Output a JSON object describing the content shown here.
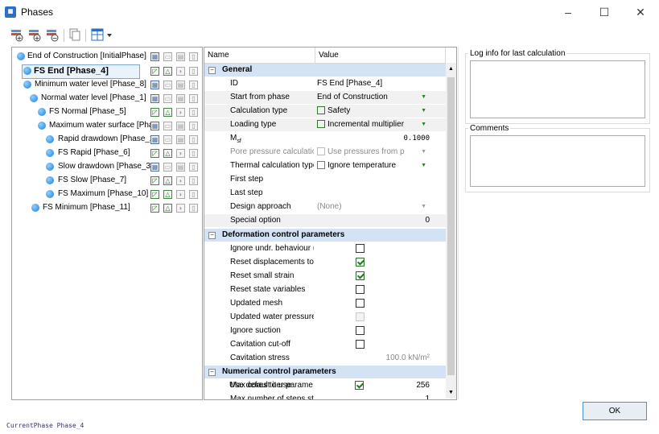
{
  "window": {
    "title": "Phases",
    "app_icon": "plaxis-icon"
  },
  "toolbar": {
    "buttons": [
      "add-phase-icon",
      "insert-phase-icon",
      "delete-phase-icon",
      "copy-icon",
      "view-options-icon"
    ]
  },
  "tree": {
    "phases": [
      {
        "label": "End of Construction [InitialPhase]",
        "indent": 0,
        "bold": false,
        "icons": [
          "calc-type-icon",
          "loading-icon",
          "pore-pressure-icon",
          "thermal-icon"
        ]
      },
      {
        "label": "FS End [Phase_4]",
        "indent": 1,
        "bold": true,
        "selected": true,
        "icons": [
          "safety-icon",
          "incremental-icon",
          "water-icon",
          "thermal-icon"
        ]
      },
      {
        "label": "Minimum water level [Phase_8]",
        "indent": 1,
        "bold": false,
        "icons": [
          "plastic-icon",
          "loading-icon",
          "pore-pressure-icon",
          "thermal-icon"
        ]
      },
      {
        "label": "Normal water level [Phase_1]",
        "indent": 2,
        "bold": false,
        "icons": [
          "plastic-icon",
          "loading-icon",
          "pore-pressure-icon",
          "thermal-icon"
        ]
      },
      {
        "label": "FS Normal [Phase_5]",
        "indent": 3,
        "bold": false,
        "icons": [
          "safety-icon",
          "incremental-icon",
          "water-icon",
          "thermal-icon"
        ]
      },
      {
        "label": "Maximum water surface [Pha",
        "indent": 3,
        "bold": false,
        "icons": [
          "plastic-icon",
          "loading-icon",
          "pore-pressure-icon",
          "thermal-icon"
        ]
      },
      {
        "label": "Rapid drawdown [Phase_2",
        "indent": 4,
        "bold": false,
        "icons": [
          "plastic-icon",
          "loading-icon",
          "pore-pressure-icon",
          "thermal-icon"
        ]
      },
      {
        "label": "FS Rapid [Phase_6]",
        "indent": 4,
        "bold": false,
        "icons": [
          "safety-icon",
          "incremental-icon",
          "water-icon",
          "thermal-icon"
        ]
      },
      {
        "label": "Slow drawdown [Phase_3]",
        "indent": 4,
        "bold": false,
        "icons": [
          "plastic-icon",
          "loading-icon",
          "pore-pressure-icon",
          "thermal-icon"
        ]
      },
      {
        "label": "FS Slow [Phase_7]",
        "indent": 4,
        "bold": false,
        "icons": [
          "safety-icon",
          "incremental-icon",
          "water-icon",
          "thermal-icon"
        ]
      },
      {
        "label": "FS Maximum [Phase_10]",
        "indent": 4,
        "bold": false,
        "icons": [
          "safety-icon",
          "incremental-icon",
          "water-icon",
          "thermal-icon"
        ]
      },
      {
        "label": "FS Minimum [Phase_11]",
        "indent": 2,
        "bold": false,
        "icons": [
          "safety-icon",
          "incremental-icon",
          "water-icon",
          "thermal-icon"
        ]
      }
    ]
  },
  "grid": {
    "col_name": "Name",
    "col_value": "Value",
    "general": {
      "title": "General",
      "id_label": "ID",
      "id_value": "FS End [Phase_4]",
      "start_label": "Start from phase",
      "start_value": "End of Construction",
      "calc_label": "Calculation type",
      "calc_value": "Safety",
      "loading_label": "Loading type",
      "loading_value": "Incremental multiplier",
      "msf_label": "M",
      "msf_sub": "sf",
      "msf_value": "0.1000",
      "pore_label": "Pore pressure calculation ty",
      "pore_value": "Use pressures from p",
      "thermal_label": "Thermal calculation type",
      "thermal_value": "Ignore temperature",
      "first_label": "First step",
      "last_label": "Last step",
      "design_label": "Design approach",
      "design_value": "(None)",
      "special_label": "Special option",
      "special_value": "0"
    },
    "deformation": {
      "title": "Deformation control parameters",
      "ignore_undr": "Ignore undr. behaviour (A,",
      "reset_disp": "Reset displacements to zer",
      "reset_strain": "Reset small strain",
      "reset_state": "Reset state variables",
      "updated_mesh": "Updated mesh",
      "updated_water": "Updated water pressure",
      "ignore_suction": "Ignore suction",
      "cavitation_cutoff": "Cavitation cut-off",
      "cavitation_stress": "Cavitation stress",
      "cavitation_stress_value": "100.0 kN/m²",
      "checks": {
        "ignore_undr": false,
        "reset_disp": true,
        "reset_strain": true,
        "reset_state": false,
        "updated_mesh": false,
        "updated_water": false,
        "ignore_suction": false,
        "cavitation_cutoff": false
      }
    },
    "numerical": {
      "title": "Numerical control parameters",
      "max_cores": "Max cores to use",
      "max_cores_value": "256",
      "max_steps": "Max number of steps store",
      "max_steps_value": "1",
      "default_iter": "Use default iter parameter:",
      "default_iter_checked": true
    }
  },
  "log": {
    "label": "Log info for last calculation"
  },
  "comments": {
    "label": "Comments"
  },
  "ok_label": "OK",
  "status": "CurrentPhase Phase_4"
}
